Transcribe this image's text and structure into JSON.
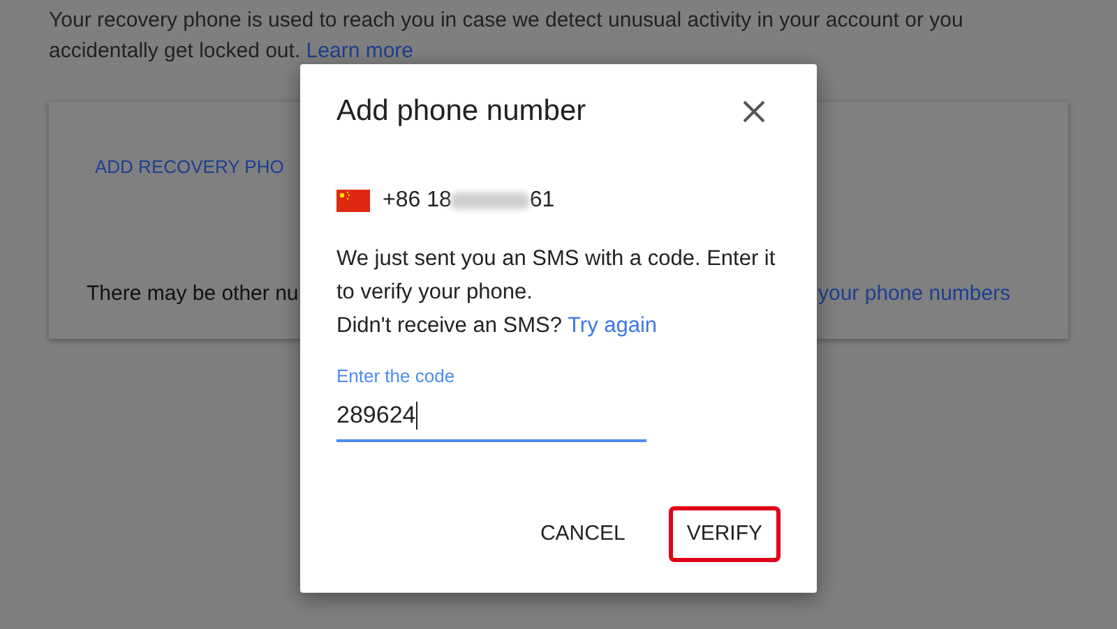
{
  "page": {
    "intro": "Your recovery phone is used to reach you in case we detect unusual activity in your account or you accidentally get locked out.",
    "intro_link": "Learn more",
    "card": {
      "add_link": "ADD RECOVERY PHO",
      "note": "There may be other nu",
      "note_link": "your phone numbers"
    }
  },
  "dialog": {
    "title": "Add phone number",
    "phone_prefix": "+86 18",
    "phone_suffix": "61",
    "phone_obscured": true,
    "message": "We just sent you an SMS with a code. Enter it to verify your phone.",
    "retry_text": "Didn't receive an SMS?",
    "retry_link": "Try again",
    "code_field": {
      "label": "Enter the code",
      "value": "289624",
      "focused": true
    },
    "buttons": [
      {
        "label": "CANCEL",
        "highlighted": false
      },
      {
        "label": "VERIFY",
        "highlighted": true
      }
    ]
  }
}
